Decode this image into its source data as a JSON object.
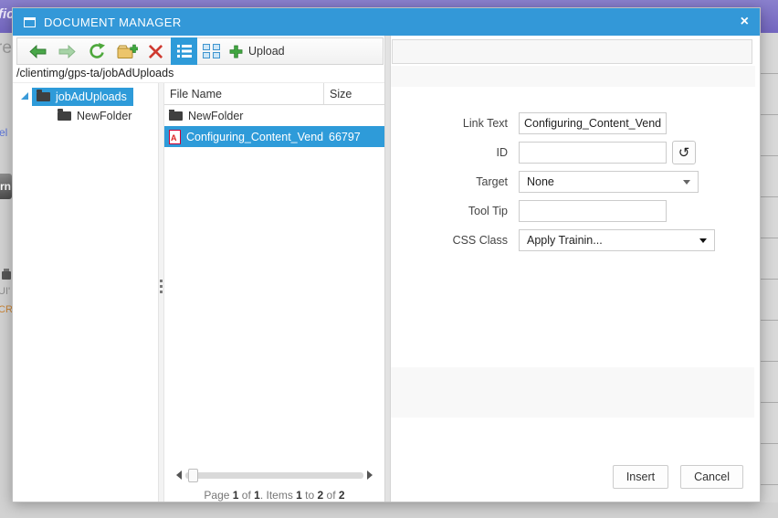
{
  "window": {
    "title": "DOCUMENT MANAGER",
    "close_glyph": "×"
  },
  "toolbar": {
    "upload_label": "Upload",
    "icons": {
      "back": "green-left-arrow",
      "forward": "green-right-arrow",
      "refresh": "green-refresh-arrows",
      "new_folder": "yellow-folder-plus",
      "delete": "red-x",
      "list_view": "list-view-toggle-active",
      "grid_view": "thumbnails-view-toggle",
      "upload": "green-plus",
      "id_reset_glyph": "↺"
    }
  },
  "path_bar": {
    "path": "/clientimg/gps-ta/jobAdUploads"
  },
  "tree": {
    "items": [
      {
        "label": "jobAdUploads",
        "selected": true
      },
      {
        "label": "NewFolder",
        "selected": false
      }
    ]
  },
  "file_list": {
    "columns": [
      {
        "label": "File Name"
      },
      {
        "label": "Size"
      }
    ],
    "rows": [
      {
        "name": "NewFolder",
        "size": "",
        "type": "folder",
        "selected": false
      },
      {
        "name": "Configuring_Content_Vendo",
        "size": "66797",
        "type": "pdf",
        "selected": true
      }
    ],
    "pager": {
      "parts": [
        {
          "t": "Page "
        },
        {
          "t": "1"
        },
        {
          "t": " of "
        },
        {
          "t": "1"
        },
        {
          "t": ". Items "
        },
        {
          "t": "1"
        },
        {
          "t": " to "
        },
        {
          "t": "2"
        },
        {
          "t": " of "
        },
        {
          "t": "2"
        }
      ]
    }
  },
  "form": {
    "link_text": {
      "label": "Link Text",
      "value": "Configuring_Content_Vendor"
    },
    "id": {
      "label": "ID",
      "value": ""
    },
    "target": {
      "label": "Target",
      "value": "None"
    },
    "tool_tip": {
      "label": "Tool Tip",
      "value": ""
    },
    "css_class": {
      "label": "CSS Class",
      "value": "Apply Trainin..."
    }
  },
  "footer": {
    "insert_label": "Insert",
    "cancel_label": "Cancel"
  },
  "background": {
    "fragments": {
      "top_left": "fic",
      "text_re": "re",
      "link_el": "el",
      "dark_button": "rn",
      "text_ui": "UI'",
      "text_cri": "CRI"
    }
  },
  "colors": {
    "titlebar_blue": "#3398d8",
    "selection_blue": "#2e9bd9",
    "backdrop_purple": "#7e72c6",
    "toolbar_green": "#46a546",
    "delete_red": "#cf3a30",
    "folder_yellow": "#ecc56b"
  }
}
